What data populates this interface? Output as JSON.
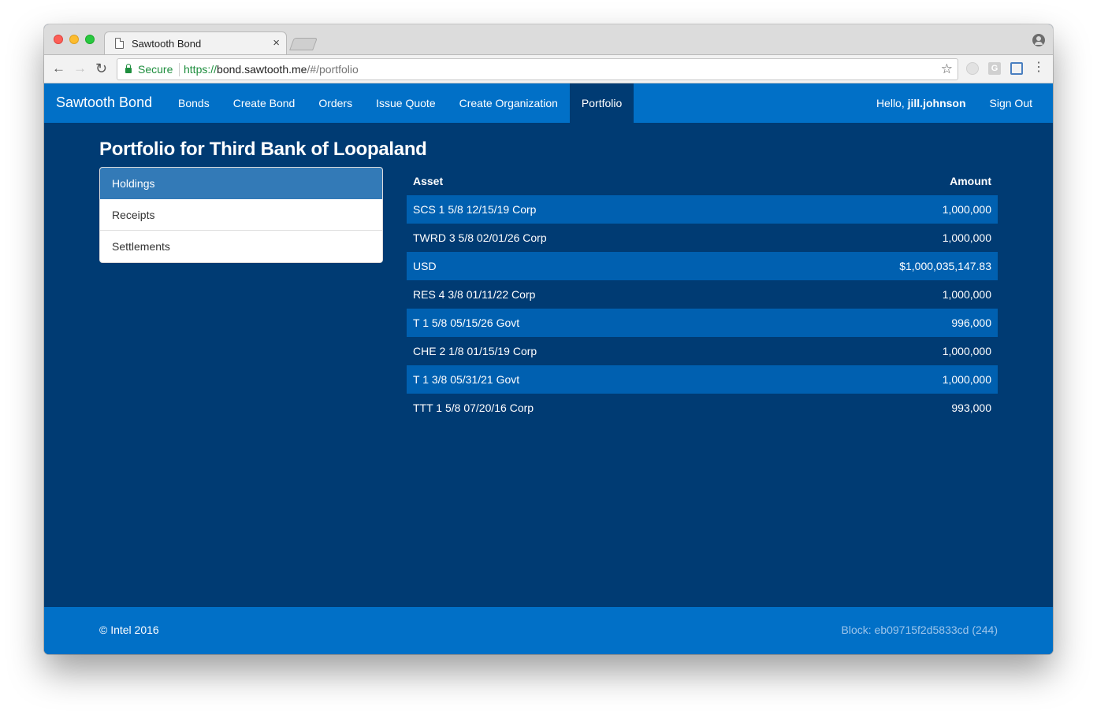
{
  "browser": {
    "tab_title": "Sawtooth Bond",
    "tab_close": "×",
    "back": "←",
    "forward": "→",
    "reload": "↻",
    "secure_label": "Secure",
    "url_scheme": "https://",
    "url_host": "bond.sawtooth.me",
    "url_path": "/#/portfolio",
    "star": "☆",
    "ext_g": "G",
    "menu": "⋮"
  },
  "navbar": {
    "brand": "Sawtooth Bond",
    "links": [
      {
        "label": "Bonds"
      },
      {
        "label": "Create Bond"
      },
      {
        "label": "Orders"
      },
      {
        "label": "Issue Quote"
      },
      {
        "label": "Create Organization"
      },
      {
        "label": "Portfolio",
        "active": true
      }
    ],
    "greeting": "Hello, ",
    "username": "jill.johnson",
    "signout": "Sign Out"
  },
  "page": {
    "title": "Portfolio for Third Bank of Loopaland"
  },
  "sidebar": {
    "items": [
      {
        "label": "Holdings",
        "active": true
      },
      {
        "label": "Receipts"
      },
      {
        "label": "Settlements"
      }
    ]
  },
  "holdings": {
    "columns": {
      "asset": "Asset",
      "amount": "Amount"
    },
    "rows": [
      {
        "asset": "SCS 1 5/8 12/15/19 Corp",
        "amount": "1,000,000"
      },
      {
        "asset": "TWRD 3 5/8 02/01/26 Corp",
        "amount": "1,000,000"
      },
      {
        "asset": "USD",
        "amount": "$1,000,035,147.83"
      },
      {
        "asset": "RES 4 3/8 01/11/22 Corp",
        "amount": "1,000,000"
      },
      {
        "asset": "T 1 5/8 05/15/26 Govt",
        "amount": "996,000"
      },
      {
        "asset": "CHE 2 1/8 01/15/19 Corp",
        "amount": "1,000,000"
      },
      {
        "asset": "T 1 3/8 05/31/21 Govt",
        "amount": "1,000,000"
      },
      {
        "asset": "TTT 1 5/8 07/20/16 Corp",
        "amount": "993,000"
      }
    ]
  },
  "footer": {
    "copyright": "© Intel 2016",
    "block": "Block: eb09715f2d5833cd (244)"
  },
  "colors": {
    "page_bg": "#003b73",
    "navbar_bg": "#0170c7",
    "row_stripe": "#0060b0",
    "list_active": "#337ab7"
  }
}
